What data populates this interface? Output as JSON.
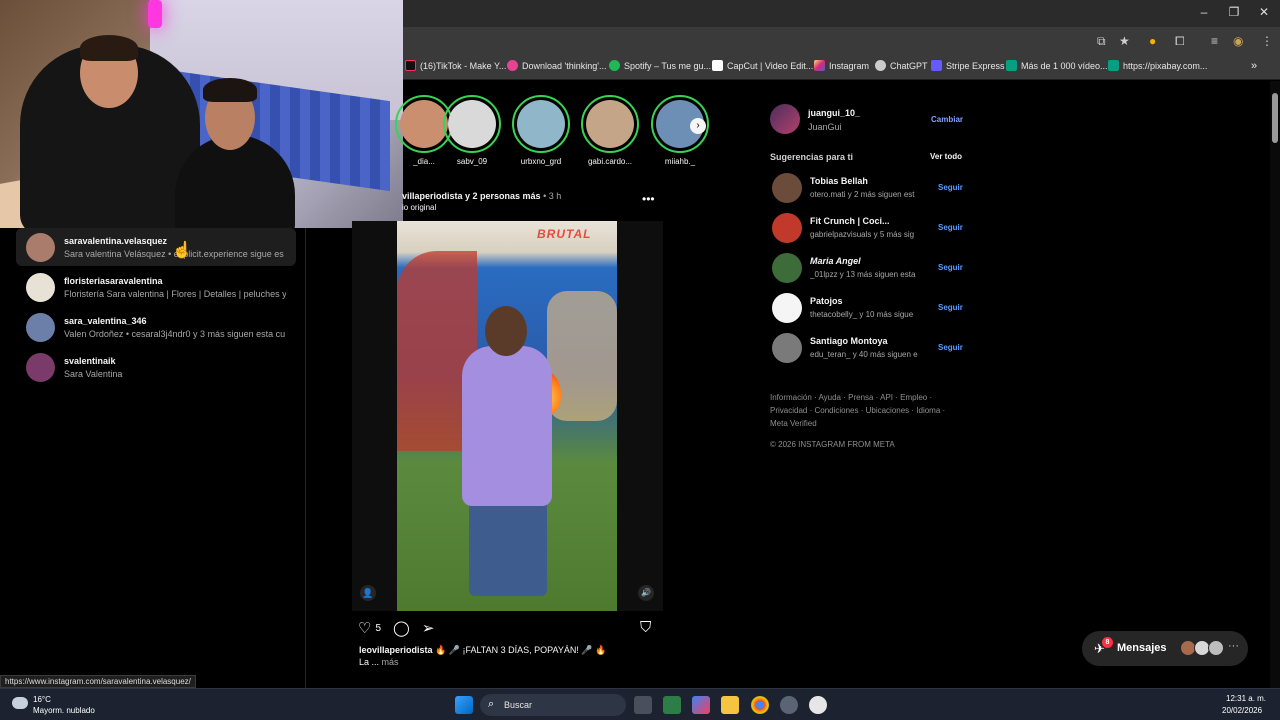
{
  "browser": {
    "bookmarks": [
      {
        "label": "(16)TikTok - Make Y...",
        "color": "#ff2d55"
      },
      {
        "label": "Download 'thinking'...",
        "color": "#e84393"
      },
      {
        "label": "Spotify – Tus me gu...",
        "color": "#1db954"
      },
      {
        "label": "CapCut | Video Edit...",
        "color": "#ffffff"
      },
      {
        "label": "Instagram",
        "color": "#e1306c"
      },
      {
        "label": "ChatGPT",
        "color": "#cccccc"
      },
      {
        "label": "Stripe Express",
        "color": "#635bff"
      },
      {
        "label": "Más de 1 000 vídeo...",
        "color": "#05a081"
      },
      {
        "label": "https://pixabay.com...",
        "color": "#05a081"
      }
    ]
  },
  "search_results": [
    {
      "name": "saravalentina.velasquez",
      "sub": "Sara valentina Velásquez • explicit.experience sigue es",
      "color": "#a97c6b"
    },
    {
      "name": "floristeriasaravalentina",
      "sub": "Floristería Sara valentina | Flores | Detalles | peluches y",
      "color": "#e8e2d6"
    },
    {
      "name": "sara_valentina_346",
      "sub": "Valen Ordoñez • cesaral3j4ndr0 y 3 más siguen esta cu",
      "color": "#6b7fa8"
    },
    {
      "name": "svalentinaik",
      "sub": "Sara Valentina",
      "color": "#7b3b6a"
    }
  ],
  "stories": [
    {
      "name": "_dia...",
      "color": "#c98f6f"
    },
    {
      "name": "sabv_09",
      "color": "#d9d9d9"
    },
    {
      "name": "urbxno_grd",
      "color": "#8fb7c9"
    },
    {
      "name": "gabi.cardo...",
      "color": "#c4a587"
    },
    {
      "name": "miiahb._",
      "color": "#6d8fb5"
    }
  ],
  "post": {
    "header": "villaperiodista y 2 personas más",
    "time": "• 3 h",
    "audio": "io original",
    "video_brand": "BRUTAL",
    "likes": "5",
    "caption_user": "leovillaperiodista",
    "caption_text": "🔥 🎤 ¡FALTAN 3 DÍAS, POPAYÁN! 🎤 🔥",
    "caption_more_prefix": "La ...",
    "caption_more": "más"
  },
  "profile": {
    "username": "juangui_10_",
    "display_name": "JuanGui",
    "switch_label": "Cambiar"
  },
  "suggestions": {
    "title": "Sugerencias para ti",
    "see_all": "Ver todo",
    "follow_label": "Seguir",
    "items": [
      {
        "name": "Tobias Bellah",
        "sub": "otero.mati y 2 más siguen est",
        "color": "#6b4b3a"
      },
      {
        "name": "Fit Crunch | Coci...",
        "sub": "gabrielpazvisuals y 5 más sig",
        "color": "#c0392b"
      },
      {
        "name": "Maria Angel",
        "sub": "_01lpzz y 13 más siguen esta",
        "color": "#3e6b3a"
      },
      {
        "name": "Patojos",
        "sub": "thetacobelly_ y 10 más sigue",
        "color": "#f5f5f5"
      },
      {
        "name": "Santiago Montoya",
        "sub": "edu_teran_ y 40 más siguen e",
        "color": "#7a7a7a"
      }
    ]
  },
  "footer": {
    "links": "Información · Ayuda · Prensa · API · Empleo · Privacidad · Condiciones · Ubicaciones · Idioma · Meta Verified",
    "copyright": "© 2026 INSTAGRAM FROM META"
  },
  "messages": {
    "label": "Mensajes",
    "badge": "8"
  },
  "status_url": "https://www.instagram.com/saravalentina.velasquez/",
  "taskbar": {
    "temperature": "16°C",
    "weather": "Mayorm. nublado",
    "search_label": "Buscar",
    "time": "12:31 a. m.",
    "date": "20/02/2026"
  }
}
